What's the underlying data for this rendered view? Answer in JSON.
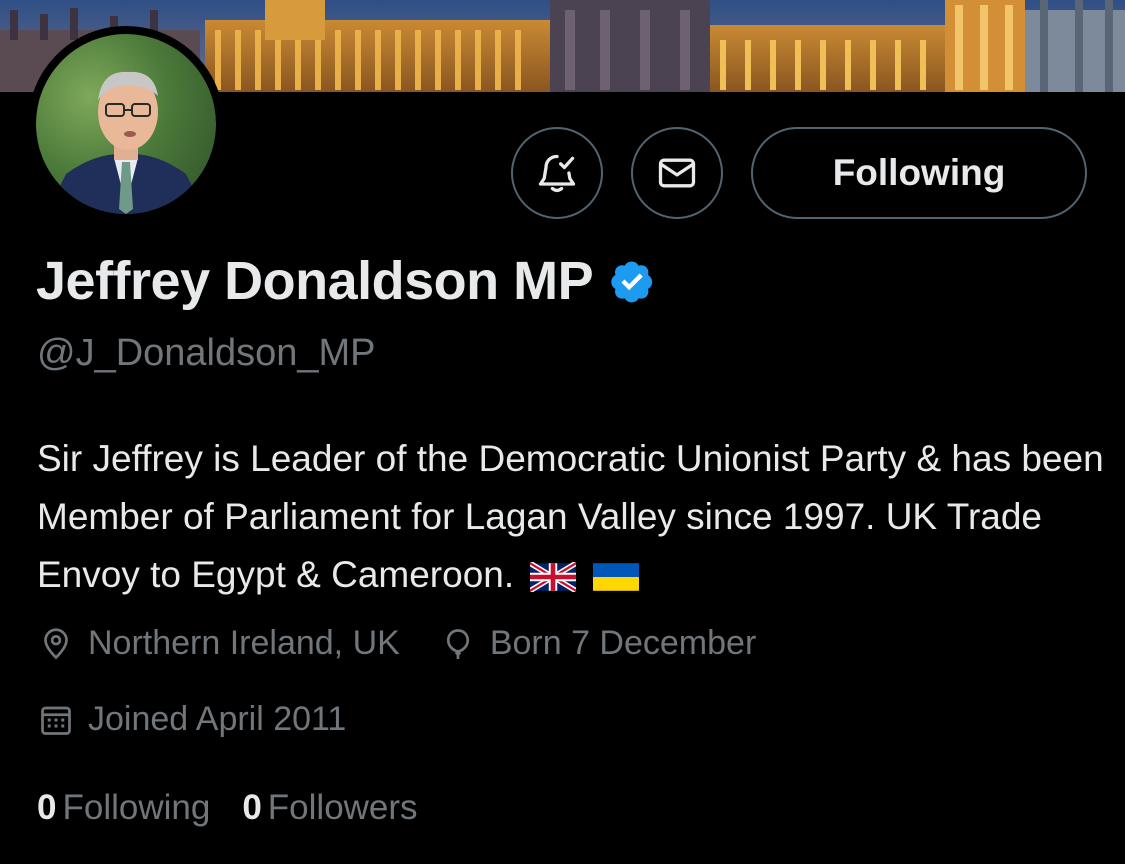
{
  "profile": {
    "display_name": "Jeffrey Donaldson MP",
    "handle": "@J_Donaldson_MP",
    "bio": "Sir Jeffrey is Leader of the Democratic Unionist Party & has been Member of Parliament for Lagan Valley since 1997. UK Trade Envoy to Egypt & Cameroon.",
    "verified": true,
    "location": "Northern Ireland, UK",
    "birthday": "Born 7 December",
    "joined": "Joined April 2011"
  },
  "actions": {
    "notify_icon": "bell-check-icon",
    "message_icon": "envelope-icon",
    "follow_label": "Following"
  },
  "stats": {
    "following_count": "0",
    "following_label": "Following",
    "followers_count": "0",
    "followers_label": "Followers"
  },
  "colors": {
    "background": "#000000",
    "text_primary": "#e7e9ea",
    "text_secondary": "#71767b",
    "border": "#536471",
    "verified_blue": "#1d9bf0"
  }
}
